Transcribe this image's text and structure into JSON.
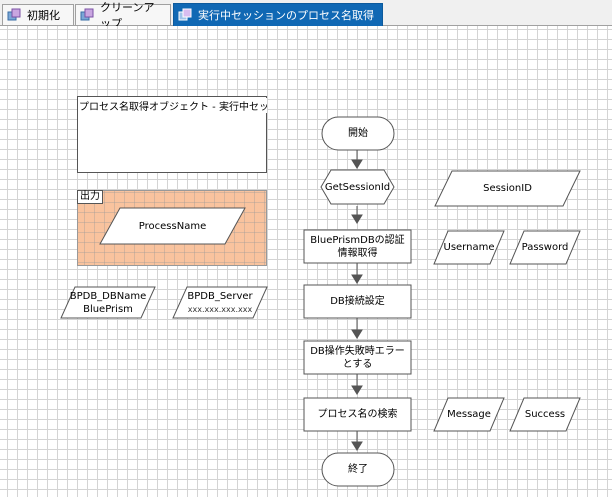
{
  "tabs": [
    {
      "label": "初期化",
      "icon": "page-icon",
      "active": false
    },
    {
      "label": "クリーンアップ",
      "icon": "page-icon",
      "active": false
    },
    {
      "label": "実行中セッションのプロセス名取得",
      "icon": "page-icon",
      "active": true
    }
  ],
  "block": {
    "title": "プロセス名取得オブジェクト - 実行中セッショ"
  },
  "output_block": {
    "title": "出力",
    "item": "ProcessName"
  },
  "data_items": {
    "bpdb_dbname": {
      "name": "BPDB_DBName",
      "value": "BluePrism"
    },
    "bpdb_server": {
      "name": "BPDB_Server",
      "value": "xxx.xxx.xxx.xxx"
    },
    "session_id": "SessionID",
    "username": "Username",
    "password": "Password",
    "message": "Message",
    "success": "Success"
  },
  "flow": {
    "start": "開始",
    "get_session": "GetSessionId",
    "get_credentials": "BluePrismDBの認証情報取得",
    "db_connect": "DB接続設定",
    "db_error": "DB操作失敗時エラーとする",
    "search": "プロセス名の検索",
    "end": "終了"
  },
  "colors": {
    "tab_active": "#1068b4",
    "output_fill": "#f9c39e",
    "connector": "#555555"
  }
}
